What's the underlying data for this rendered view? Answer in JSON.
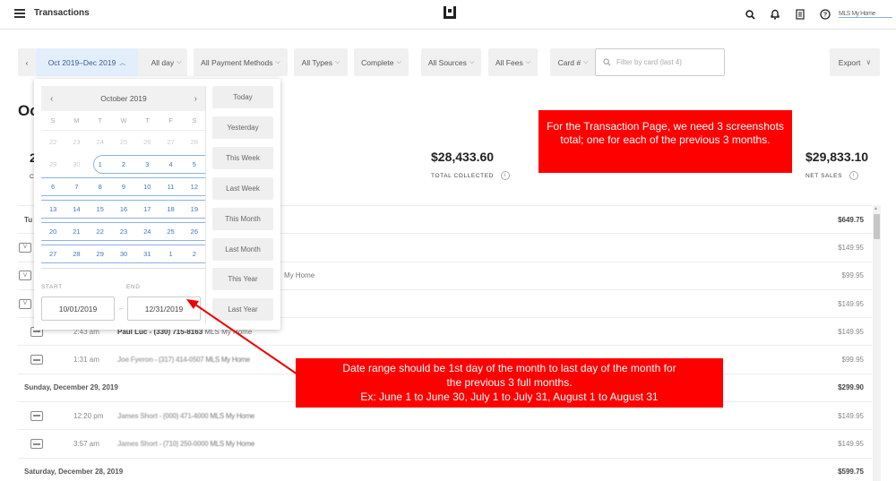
{
  "topbar": {
    "title": "Transactions",
    "user_name": "MLS My Home",
    "icons": [
      "menu-icon",
      "logo-icon",
      "search-icon",
      "bell-icon",
      "receipt-icon",
      "help-icon"
    ]
  },
  "filters": {
    "prev": "‹",
    "date_range": "Oct 2019–Dec 2019",
    "date_range_caret": "^",
    "next": "›",
    "time": "All day",
    "payment_methods": "All Payment Methods",
    "types": "All Types",
    "status": "Complete",
    "sources": "All Sources",
    "fees": "All Fees",
    "card": "Card #",
    "card_search_placeholder": "Filter by card (last 4)",
    "export": "Export",
    "caret": "⌄"
  },
  "summary": {
    "heading": "Oct",
    "left_value": "2",
    "left_label": "C",
    "total_collected_value": "$28,433.60",
    "total_collected_label": "TOTAL COLLECTED",
    "net_sales_value": "$29,833.10",
    "net_sales_label": "NET SALES",
    "info": "i"
  },
  "rows": [
    {
      "type": "date",
      "label": "Tu",
      "amount": "$649.75"
    },
    {
      "type": "txn",
      "icon": "V",
      "time": "",
      "name": "",
      "source": "",
      "amount": "$149.95"
    },
    {
      "type": "txn",
      "icon": "V",
      "time": "",
      "name": "",
      "source": "My Home",
      "amount": "$99.95"
    },
    {
      "type": "txn",
      "icon": "V",
      "time": "",
      "name": "",
      "source": "",
      "amount": "$149.95"
    },
    {
      "type": "txn",
      "icon": "card",
      "time": "2:43 am",
      "name": "Paul Luc - (330) 715-8163",
      "source": "MLS My Home",
      "amount": "$149.95"
    },
    {
      "type": "txn",
      "icon": "card",
      "time": "1:31 am",
      "name": "Joe Fyeron - (317) 414-0507",
      "source": "MLS My Home",
      "amount": "$99.95",
      "blurred": true
    },
    {
      "type": "date",
      "label": "Sunday, December 29, 2019",
      "amount": "$299.90"
    },
    {
      "type": "txn",
      "icon": "card",
      "time": "12:20 pm",
      "name": "James Short - (000) 471-4000",
      "source": "MLS My Home",
      "amount": "$149.95",
      "blurred": true
    },
    {
      "type": "txn",
      "icon": "card",
      "time": "3:57 am",
      "name": "James Short - (710) 250-0000",
      "source": "MLS My Home",
      "amount": "$149.95",
      "blurred": true
    },
    {
      "type": "date",
      "label": "Saturday, December 28, 2019",
      "amount": "$599.75"
    }
  ],
  "picker": {
    "month_label": "October 2019",
    "prev": "‹",
    "next": "›",
    "weekdays": [
      "S",
      "M",
      "T",
      "W",
      "T",
      "F",
      "S"
    ],
    "weeks": [
      {
        "days": [
          "22",
          "23",
          "24",
          "25",
          "26",
          "27",
          "28"
        ],
        "muted": [
          0,
          1,
          2,
          3,
          4,
          5,
          6
        ],
        "selected": false
      },
      {
        "days": [
          "29",
          "30",
          "1",
          "2",
          "3",
          "4",
          "5"
        ],
        "muted": [
          0,
          1
        ],
        "selected": true,
        "first": true
      },
      {
        "days": [
          "6",
          "7",
          "8",
          "9",
          "10",
          "11",
          "12"
        ],
        "muted": [],
        "selected": true
      },
      {
        "days": [
          "13",
          "14",
          "15",
          "16",
          "17",
          "18",
          "19"
        ],
        "muted": [],
        "selected": true
      },
      {
        "days": [
          "20",
          "21",
          "22",
          "23",
          "24",
          "25",
          "26"
        ],
        "muted": [],
        "selected": true
      },
      {
        "days": [
          "27",
          "28",
          "29",
          "30",
          "31",
          "1",
          "2"
        ],
        "muted": [],
        "selected": true
      }
    ],
    "start_label": "START",
    "end_label": "END",
    "start_value": "10/01/2019",
    "end_value": "12/31/2019",
    "range_dash": "–",
    "presets": [
      "Today",
      "Yesterday",
      "This Week",
      "Last Week",
      "This Month",
      "Last Month",
      "This Year",
      "Last Year"
    ]
  },
  "annotations": {
    "note1": "For the Transaction Page, we need 3 screenshots total; one for each of the previous 3 months.",
    "note2_line1": "Date range should be 1st day of the month to last day of the month for",
    "note2_line2": "the previous 3 full months.",
    "note2_line3": "Ex: June 1 to June 30, July 1 to July 31, August 1 to August 31",
    "color": "#ff0000"
  }
}
